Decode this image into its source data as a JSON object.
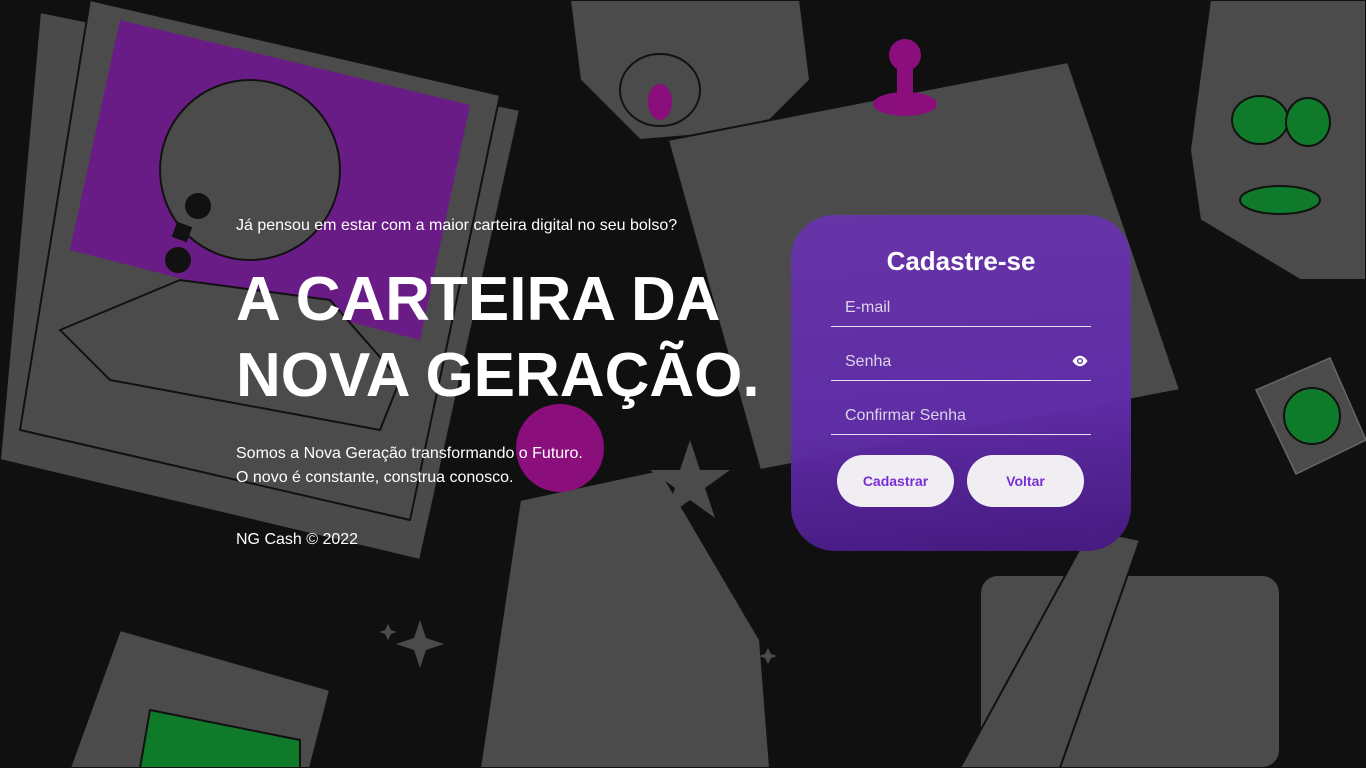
{
  "hero": {
    "tagline": "Já pensou em estar com a maior carteira digital no seu bolso?",
    "title_line1": "A CARTEIRA DA",
    "title_line2": "NOVA GERAÇÃO.",
    "description_line1": "Somos a Nova Geração transformando o Futuro.",
    "description_line2": "O novo é constante, construa conosco.",
    "footer": "NG Cash © 2022"
  },
  "signup": {
    "title": "Cadastre-se",
    "email_placeholder": "E-mail",
    "password_placeholder": "Senha",
    "confirm_placeholder": "Confirmar Senha",
    "register_label": "Cadastrar",
    "back_label": "Voltar",
    "eye_icon": "eye-icon"
  },
  "colors": {
    "background": "#101010",
    "card": "#6334aa",
    "button_bg": "#f0eef2",
    "button_text": "#7a2fd6",
    "illustration_gray": "#4a4a4a",
    "illustration_purple": "#8a0f7c",
    "illustration_green": "#0f7a2a"
  }
}
